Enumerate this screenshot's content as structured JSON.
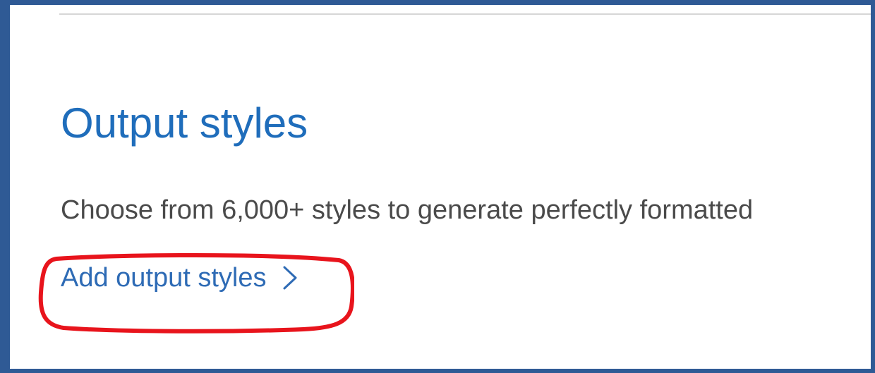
{
  "section": {
    "title": "Output styles",
    "description": "Choose from 6,000+ styles to generate perfectly formatted",
    "link_label": "Add output styles"
  },
  "icons": {
    "link_icon": "chevron-right-icon"
  },
  "colors": {
    "frame_border": "#2f5a95",
    "title": "#1f6dbb",
    "link": "#2e6bb5",
    "description_text": "#4a4a4a",
    "highlight": "#e8141c"
  }
}
